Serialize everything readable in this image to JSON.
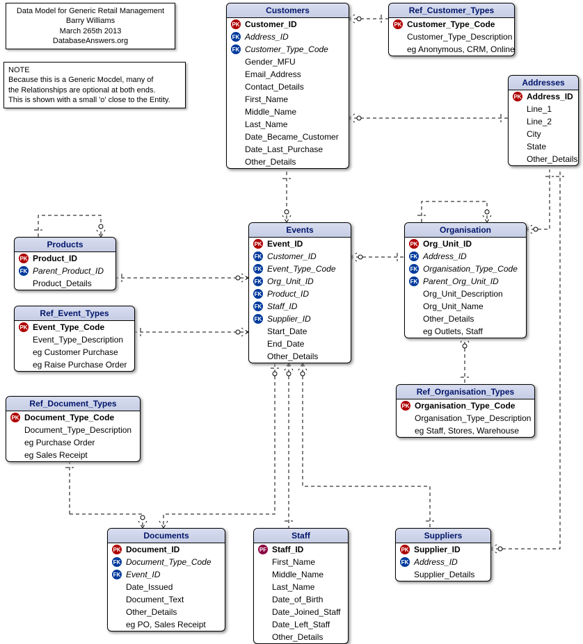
{
  "meta_box": {
    "l1": "Data Model for Generic Retail Management",
    "l2": "Barry Williams",
    "l3": "March 265th 2013",
    "l4": "DatabaseAnswers.org"
  },
  "note_box": {
    "l1": "NOTE",
    "l2": "Because this is a Generic Mocdel, many of",
    "l3": "the Relationships are optional at both ends.",
    "l4": "This is shown with a small 'o' close to the Entity."
  },
  "entities": {
    "customers": {
      "title": "Customers",
      "fields": [
        {
          "k": "pk",
          "t": "Customer_ID",
          "b": true
        },
        {
          "k": "fk",
          "t": "Address_ID",
          "i": true
        },
        {
          "k": "fk",
          "t": "Customer_Type_Code",
          "i": true
        },
        {
          "k": "",
          "t": "Gender_MFU"
        },
        {
          "k": "",
          "t": "Email_Address"
        },
        {
          "k": "",
          "t": "Contact_Details"
        },
        {
          "k": "",
          "t": "First_Name"
        },
        {
          "k": "",
          "t": "Middle_Name"
        },
        {
          "k": "",
          "t": "Last_Name"
        },
        {
          "k": "",
          "t": "Date_Became_Customer"
        },
        {
          "k": "",
          "t": "Date_Last_Purchase"
        },
        {
          "k": "",
          "t": "Other_Details"
        }
      ]
    },
    "ref_customer_types": {
      "title": "Ref_Customer_Types",
      "fields": [
        {
          "k": "pk",
          "t": "Customer_Type_Code",
          "b": true
        },
        {
          "k": "",
          "t": "Customer_Type_Description"
        },
        {
          "k": "",
          "t": "eg Anonymous, CRM, Online"
        }
      ]
    },
    "addresses": {
      "title": "Addresses",
      "fields": [
        {
          "k": "pk",
          "t": "Address_ID",
          "b": true
        },
        {
          "k": "",
          "t": "Line_1"
        },
        {
          "k": "",
          "t": "Line_2"
        },
        {
          "k": "",
          "t": "City"
        },
        {
          "k": "",
          "t": "State"
        },
        {
          "k": "",
          "t": "Other_Details"
        }
      ]
    },
    "products": {
      "title": "Products",
      "fields": [
        {
          "k": "pk",
          "t": "Product_ID",
          "b": true
        },
        {
          "k": "fk",
          "t": "Parent_Product_ID",
          "i": true
        },
        {
          "k": "",
          "t": "Product_Details"
        }
      ]
    },
    "events": {
      "title": "Events",
      "fields": [
        {
          "k": "pk",
          "t": "Event_ID",
          "b": true
        },
        {
          "k": "fk",
          "t": "Customer_ID",
          "i": true
        },
        {
          "k": "fk",
          "t": "Event_Type_Code",
          "i": true
        },
        {
          "k": "fk",
          "t": "Org_Unit_ID",
          "i": true
        },
        {
          "k": "fk",
          "t": "Product_ID",
          "i": true
        },
        {
          "k": "fk",
          "t": "Staff_ID",
          "i": true
        },
        {
          "k": "fk",
          "t": "Supplier_ID",
          "i": true
        },
        {
          "k": "",
          "t": "Start_Date"
        },
        {
          "k": "",
          "t": "End_Date"
        },
        {
          "k": "",
          "t": "Other_Details"
        }
      ]
    },
    "organisation": {
      "title": "Organisation",
      "fields": [
        {
          "k": "pk",
          "t": "Org_Unit_ID",
          "b": true
        },
        {
          "k": "fk",
          "t": "Address_ID",
          "i": true
        },
        {
          "k": "fk",
          "t": "Organisation_Type_Code",
          "i": true
        },
        {
          "k": "fk",
          "t": "Parent_Org_Unit_ID",
          "i": true
        },
        {
          "k": "",
          "t": "Org_Unit_Description"
        },
        {
          "k": "",
          "t": "Org_Unit_Name"
        },
        {
          "k": "",
          "t": "Other_Details"
        },
        {
          "k": "",
          "t": "eg Outlets, Staff"
        }
      ]
    },
    "ref_event_types": {
      "title": "Ref_Event_Types",
      "fields": [
        {
          "k": "pk",
          "t": "Event_Type_Code",
          "b": true
        },
        {
          "k": "",
          "t": "Event_Type_Description"
        },
        {
          "k": "",
          "t": "eg Customer Purchase"
        },
        {
          "k": "",
          "t": "eg Raise Purchase Order"
        }
      ]
    },
    "ref_organisation_types": {
      "title": "Ref_Organisation_Types",
      "fields": [
        {
          "k": "pk",
          "t": "Organisation_Type_Code",
          "b": true
        },
        {
          "k": "",
          "t": "Organisation_Type_Description"
        },
        {
          "k": "",
          "t": "eg Staff, Stores, Warehouse"
        }
      ]
    },
    "ref_document_types": {
      "title": "Ref_Document_Types",
      "fields": [
        {
          "k": "pk",
          "t": "Document_Type_Code",
          "b": true
        },
        {
          "k": "",
          "t": "Document_Type_Description"
        },
        {
          "k": "",
          "t": "eg Purchase Order"
        },
        {
          "k": "",
          "t": "eg Sales Receipt"
        }
      ]
    },
    "documents": {
      "title": "Documents",
      "fields": [
        {
          "k": "pk",
          "t": "Document_ID",
          "b": true
        },
        {
          "k": "fk",
          "t": "Document_Type_Code",
          "i": true
        },
        {
          "k": "fk",
          "t": "Event_ID",
          "i": true
        },
        {
          "k": "",
          "t": "Date_Issued"
        },
        {
          "k": "",
          "t": "Document_Text"
        },
        {
          "k": "",
          "t": "Other_Details"
        },
        {
          "k": "",
          "t": "eg PO, Sales Receipt"
        }
      ]
    },
    "staff": {
      "title": "Staff",
      "fields": [
        {
          "k": "pf",
          "t": "Staff_ID",
          "b": true
        },
        {
          "k": "",
          "t": "First_Name"
        },
        {
          "k": "",
          "t": "Middle_Name"
        },
        {
          "k": "",
          "t": "Last_Name"
        },
        {
          "k": "",
          "t": "Date_of_Birth"
        },
        {
          "k": "",
          "t": "Date_Joined_Staff"
        },
        {
          "k": "",
          "t": "Date_Left_Staff"
        },
        {
          "k": "",
          "t": "Other_Details"
        }
      ]
    },
    "suppliers": {
      "title": "Suppliers",
      "fields": [
        {
          "k": "pk",
          "t": "Supplier_ID",
          "b": true
        },
        {
          "k": "fk",
          "t": "Address_ID",
          "i": true
        },
        {
          "k": "",
          "t": "Supplier_Details"
        }
      ]
    }
  },
  "icon_labels": {
    "pk": "PK",
    "fk": "FK",
    "pf": "PF"
  }
}
